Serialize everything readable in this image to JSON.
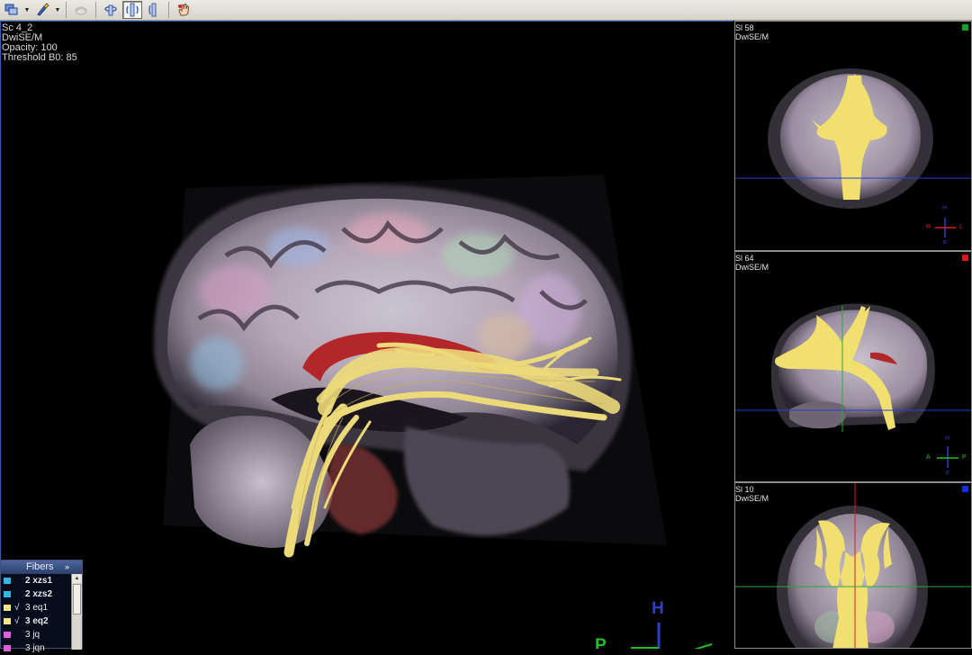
{
  "toolbar": {
    "icons": [
      "layers-icon",
      "brush-icon",
      "eraser-icon",
      "rotate-axial-icon",
      "rotate-sagittal-icon",
      "rotate-coronal-icon",
      "hand-pan-icon"
    ]
  },
  "main_view": {
    "overlay_lines": [
      "Sc 4_2",
      "DwiSE/M",
      "Opacity: 100",
      "Threshold B0: 85"
    ],
    "axis_label_top": "H",
    "axis_label_left": "P"
  },
  "viewports": [
    {
      "slice": "Sl 58",
      "series": "DwiSE/M",
      "marker_color": "#0aa51e",
      "orient_left": "R",
      "orient_right": "L",
      "orient_top": "H",
      "orient_bottom": "F",
      "left_color": "#e02020",
      "right_color": "#e02020"
    },
    {
      "slice": "Sl 64",
      "series": "DwiSE/M",
      "marker_color": "#e01515",
      "orient_left": "A",
      "orient_right": "P",
      "orient_top": "H",
      "orient_bottom": "F",
      "left_color": "#20c020",
      "right_color": "#20c020"
    },
    {
      "slice": "Sl 10",
      "series": "DwiSE/M",
      "marker_color": "#1530e0"
    }
  ],
  "fibers_panel": {
    "title": "Fibers",
    "expand": "»",
    "items": [
      {
        "name": "2 xzs1",
        "color": "#35b5e6",
        "checked": false,
        "bold": true
      },
      {
        "name": "2 xzs2",
        "color": "#35b5e6",
        "checked": false,
        "bold": true
      },
      {
        "name": "3 eq1",
        "color": "#f3e784",
        "checked": true,
        "bold": false
      },
      {
        "name": "3 eq2",
        "color": "#f3e784",
        "checked": true,
        "bold": true
      },
      {
        "name": "3 jq",
        "color": "#e05fd8",
        "checked": false,
        "bold": false
      },
      {
        "name": "3 jqn",
        "color": "#e05fd8",
        "checked": false,
        "bold": false
      }
    ],
    "check_mark": "√"
  },
  "colors": {
    "fiber_yellow": "#ecd97a",
    "toolbar_bg": "#dcd9d1",
    "viewport_border": "#8e8e8e",
    "crosshair_blue": "#2a3fd0",
    "crosshair_green": "#2aa83a",
    "crosshair_red": "#d02020"
  }
}
